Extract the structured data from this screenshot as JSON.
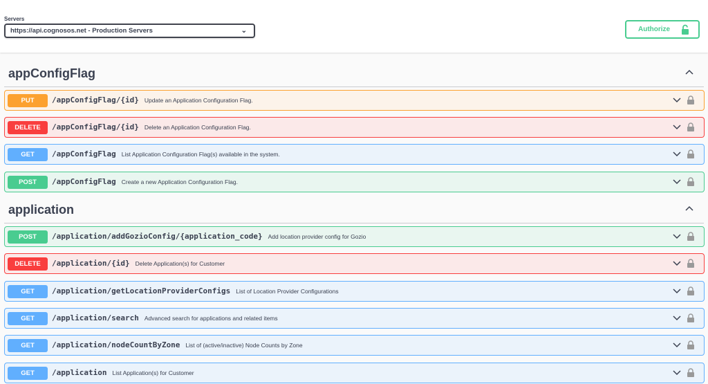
{
  "servers": {
    "label": "Servers",
    "selected": "https://api.cognosos.net - Production Servers"
  },
  "authorize": {
    "label": "Authorize"
  },
  "colors": {
    "put": "#fca130",
    "delete": "#f93e3e",
    "get": "#61affe",
    "post": "#49cc90"
  },
  "tags": [
    {
      "name": "appConfigFlag",
      "operations": [
        {
          "method": "PUT",
          "path": "/appConfigFlag/{id}",
          "summary": "Update an Application Configuration Flag."
        },
        {
          "method": "DELETE",
          "path": "/appConfigFlag/{id}",
          "summary": "Delete an Application Configuration Flag."
        },
        {
          "method": "GET",
          "path": "/appConfigFlag",
          "summary": "List Application Configuration Flag(s) available in the system."
        },
        {
          "method": "POST",
          "path": "/appConfigFlag",
          "summary": "Create a new Application Configuration Flag."
        }
      ]
    },
    {
      "name": "application",
      "operations": [
        {
          "method": "POST",
          "path": "/application/addGozioConfig/{application_code}",
          "summary": "Add location provider config for Gozio"
        },
        {
          "method": "DELETE",
          "path": "/application/{id}",
          "summary": "Delete Application(s) for Customer"
        },
        {
          "method": "GET",
          "path": "/application/getLocationProviderConfigs",
          "summary": "List of Location Provider Configurations"
        },
        {
          "method": "GET",
          "path": "/application/search",
          "summary": "Advanced search for applications and related items"
        },
        {
          "method": "GET",
          "path": "/application/nodeCountByZone",
          "summary": "List of (active/inactive) Node Counts by Zone"
        },
        {
          "method": "GET",
          "path": "/application",
          "summary": "List Application(s) for Customer"
        }
      ]
    }
  ]
}
